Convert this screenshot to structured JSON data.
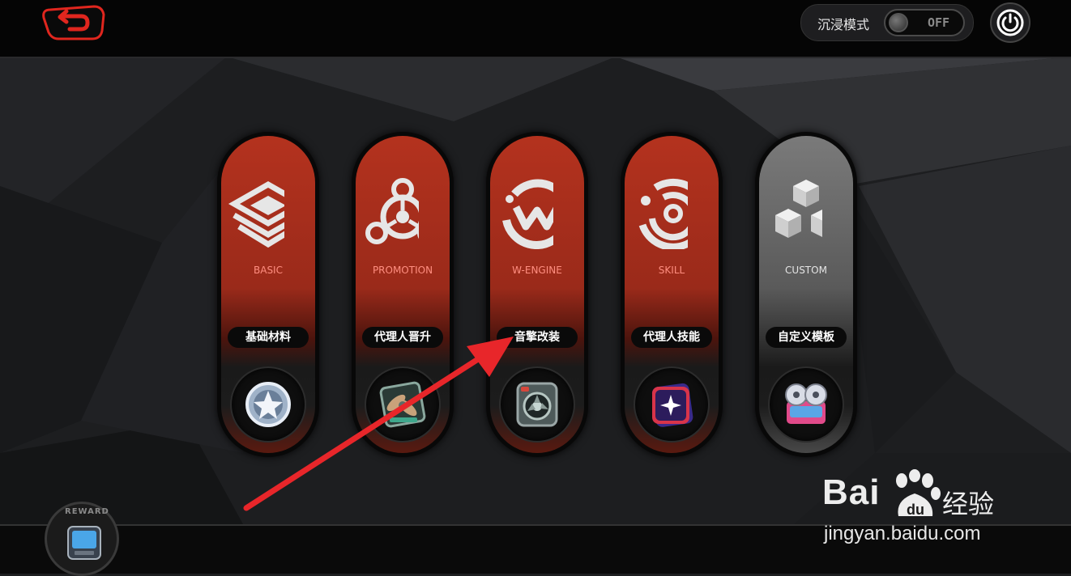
{
  "topbar": {
    "immersive_label": "沉浸模式",
    "immersive_toggle_state": "OFF"
  },
  "cards": [
    {
      "en": "BASIC",
      "cn": "基础材料",
      "icon": "stacked-diamond-layers-icon",
      "medal": "silver-star-medal-icon",
      "theme": "red"
    },
    {
      "en": "PROMOTION",
      "cn": "代理人晋升",
      "icon": "tri-node-ring-icon",
      "medal": "propeller-box-icon",
      "theme": "red"
    },
    {
      "en": "W-ENGINE",
      "cn": "音擎改装",
      "icon": "w-engine-ring-icon",
      "medal": "speaker-device-icon",
      "theme": "red"
    },
    {
      "en": "SKILL",
      "cn": "代理人技能",
      "icon": "concentric-ring-icon",
      "medal": "sparkle-card-icon",
      "theme": "red"
    },
    {
      "en": "CUSTOM",
      "cn": "自定义模板",
      "icon": "stacked-cubes-icon",
      "medal": "film-reel-icon",
      "theme": "grey"
    }
  ],
  "reward": {
    "label": "REWARD",
    "icon": "reward-device-icon"
  },
  "watermark": {
    "logo_bai": "Bai",
    "logo_du": "du",
    "logo_cn": "经验",
    "url": "jingyan.baidu.com"
  },
  "colors": {
    "accent_red": "#b4321e",
    "back_red": "#e0261e",
    "annotation_arrow": "#e8262a",
    "custom_grey": "#7a7a7a"
  }
}
